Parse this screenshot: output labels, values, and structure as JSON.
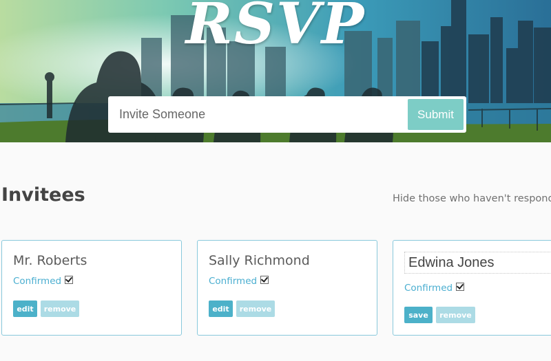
{
  "header": {
    "logo": "RSVP",
    "invite_placeholder": "Invite Someone",
    "submit_label": "Submit"
  },
  "main": {
    "title": "Invitees",
    "filter_label": "Hide those who haven't responde"
  },
  "invitees": [
    {
      "name": "Mr. Roberts",
      "confirmed_label": "Confirmed",
      "confirmed": true,
      "edit_label": "edit",
      "remove_label": "remove"
    },
    {
      "name": "Sally Richmond",
      "confirmed_label": "Confirmed",
      "confirmed": true,
      "edit_label": "edit",
      "remove_label": "remove"
    },
    {
      "name": "Edwina Jones",
      "confirmed_label": "Confirmed",
      "confirmed": true,
      "save_label": "save",
      "remove_label": "remove",
      "editing": true
    }
  ],
  "colors": {
    "accent": "#4cb1c9",
    "accent_light": "#acdbe5",
    "submit": "#7dcdc6",
    "card_border": "#88c8db",
    "confirmed_text": "#4aaed0"
  }
}
